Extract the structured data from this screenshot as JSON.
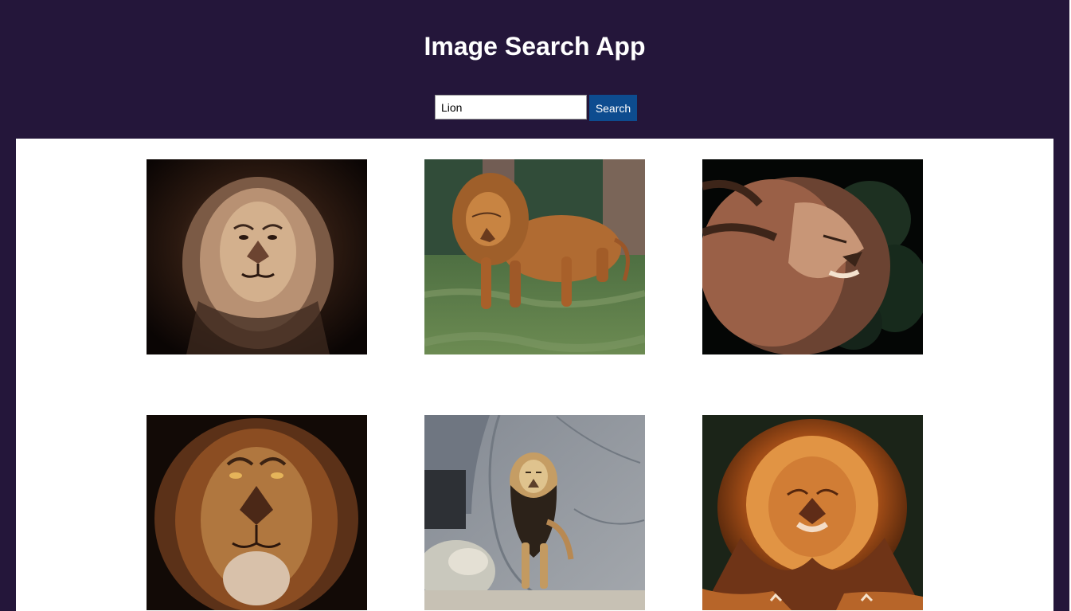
{
  "header": {
    "title": "Image Search App"
  },
  "search": {
    "value": "Lion",
    "button_label": "Search"
  },
  "results": [
    {
      "icon": "lion-photo-icon"
    },
    {
      "icon": "lion-photo-icon"
    },
    {
      "icon": "lion-photo-icon"
    },
    {
      "icon": "lion-photo-icon"
    },
    {
      "icon": "lion-photo-icon"
    },
    {
      "icon": "lion-photo-icon"
    }
  ],
  "colors": {
    "background": "#24163a",
    "results_panel": "#ffffff",
    "search_button": "#0d4c8f",
    "title_text": "#ffffff"
  }
}
